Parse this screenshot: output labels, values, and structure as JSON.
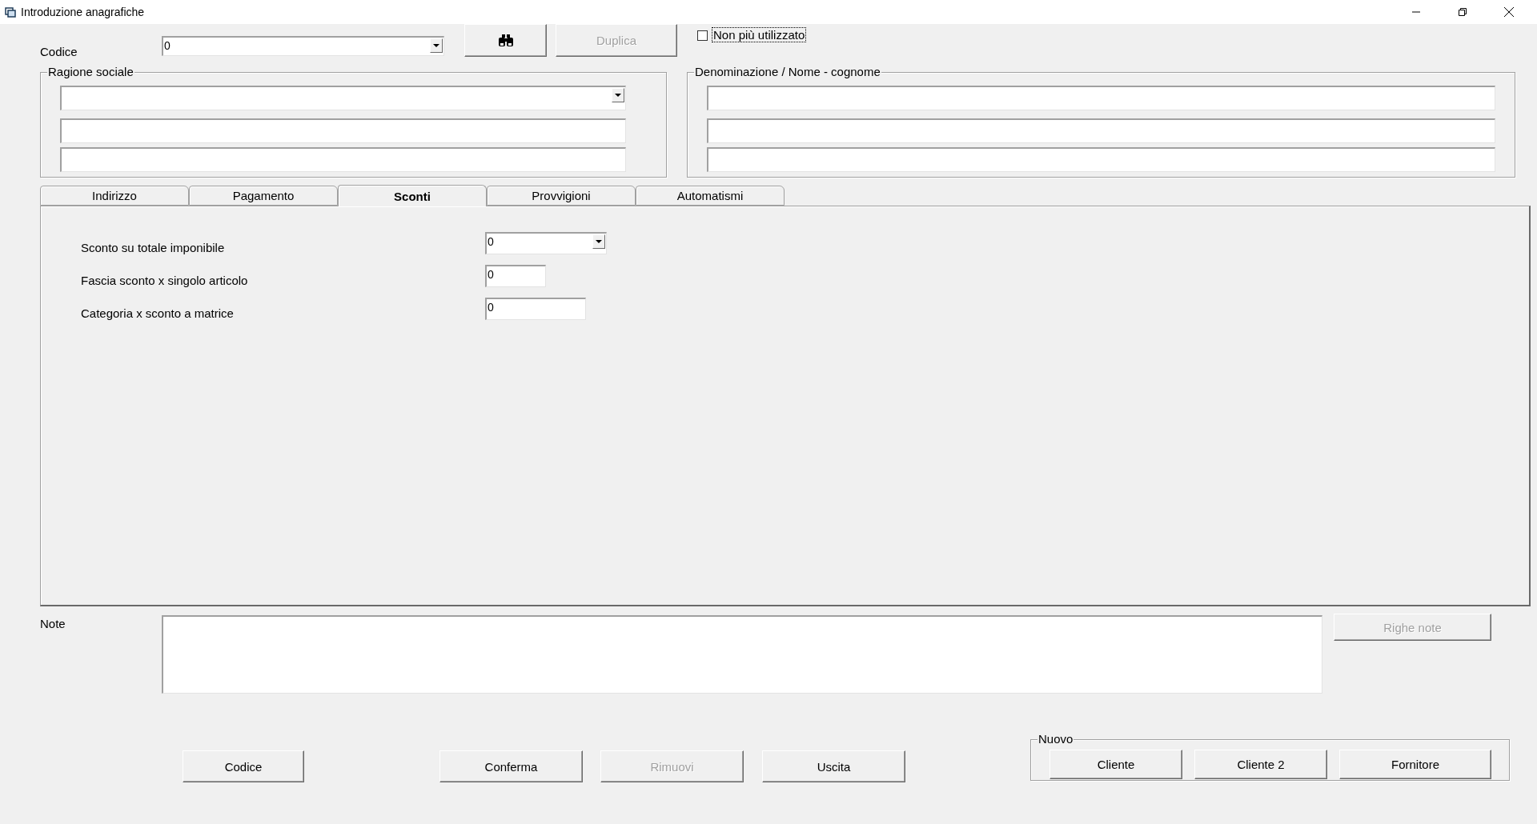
{
  "window": {
    "title": "Introduzione anagrafiche"
  },
  "header": {
    "code_label": "Codice",
    "code_value": "0",
    "search_button": {
      "disabled": false
    },
    "duplicate_button": {
      "label": "Duplica",
      "disabled": true
    },
    "unused_checkbox": {
      "label": "Non più utilizzato",
      "checked": false
    }
  },
  "company_group": {
    "title": "Ragione sociale",
    "fields": [
      {
        "kind": "combo"
      },
      {
        "kind": "text"
      },
      {
        "kind": "text"
      }
    ]
  },
  "name_group": {
    "title": "Denominazione / Nome - cognome",
    "fields": [
      {
        "kind": "text"
      },
      {
        "kind": "text"
      },
      {
        "kind": "text"
      }
    ]
  },
  "tabs": [
    {
      "label": "Indirizzo",
      "selected": false
    },
    {
      "label": "Pagamento",
      "selected": false
    },
    {
      "label": "Sconti",
      "selected": true
    },
    {
      "label": "Provvigioni",
      "selected": false
    },
    {
      "label": "Automatismi",
      "selected": false
    }
  ],
  "discounts": [
    {
      "label": "Sconto su totale imponibile",
      "value": "0",
      "kind": "combo"
    },
    {
      "label": "Fascia sconto x singolo articolo",
      "value": "0",
      "kind": "short"
    },
    {
      "label": "Categoria x sconto a matrice",
      "value": "0",
      "kind": "medium"
    }
  ],
  "notes": {
    "label": "Note",
    "button": {
      "label": "Righe note",
      "disabled": true
    }
  },
  "actions": [
    {
      "label": "Codice",
      "disabled": false
    },
    {
      "label": "Conferma",
      "disabled": false
    },
    {
      "label": "Rimuovi",
      "disabled": true
    },
    {
      "label": "Uscita",
      "disabled": false
    }
  ],
  "new_group": {
    "title": "Nuovo",
    "buttons": [
      {
        "label": "Cliente",
        "disabled": false
      },
      {
        "label": "Cliente 2",
        "disabled": false
      },
      {
        "label": "Fornitore",
        "disabled": false
      }
    ]
  }
}
